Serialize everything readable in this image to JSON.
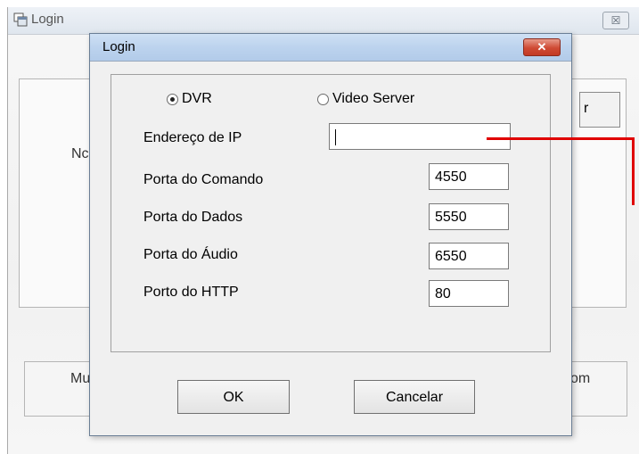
{
  "background_window": {
    "title": "Login",
    "close_label": "☒",
    "label_partial_left": "Nc",
    "button_partial_right": "r",
    "label_partial_bottom_left": "Mu",
    "label_partial_bottom_right": "om"
  },
  "dialog": {
    "title": "Login",
    "close_label": "✕",
    "radios": [
      {
        "label": "DVR",
        "checked": true
      },
      {
        "label": "Video Server",
        "checked": false
      }
    ],
    "fields": [
      {
        "label": "Endereço de IP",
        "value": ""
      },
      {
        "label": "Porta do Comando",
        "value": "4550"
      },
      {
        "label": "Porta do Dados",
        "value": "5550"
      },
      {
        "label": "Porta do Áudio",
        "value": "6550"
      },
      {
        "label": "Porto do HTTP",
        "value": "80"
      }
    ],
    "ok_label": "OK",
    "cancel_label": "Cancelar"
  },
  "colors": {
    "annotation": "#e00000",
    "close_button": "#c23a25"
  },
  "icons": [
    "app-window-icon",
    "close-icon",
    "radio-selected-icon",
    "radio-unselected-icon"
  ]
}
